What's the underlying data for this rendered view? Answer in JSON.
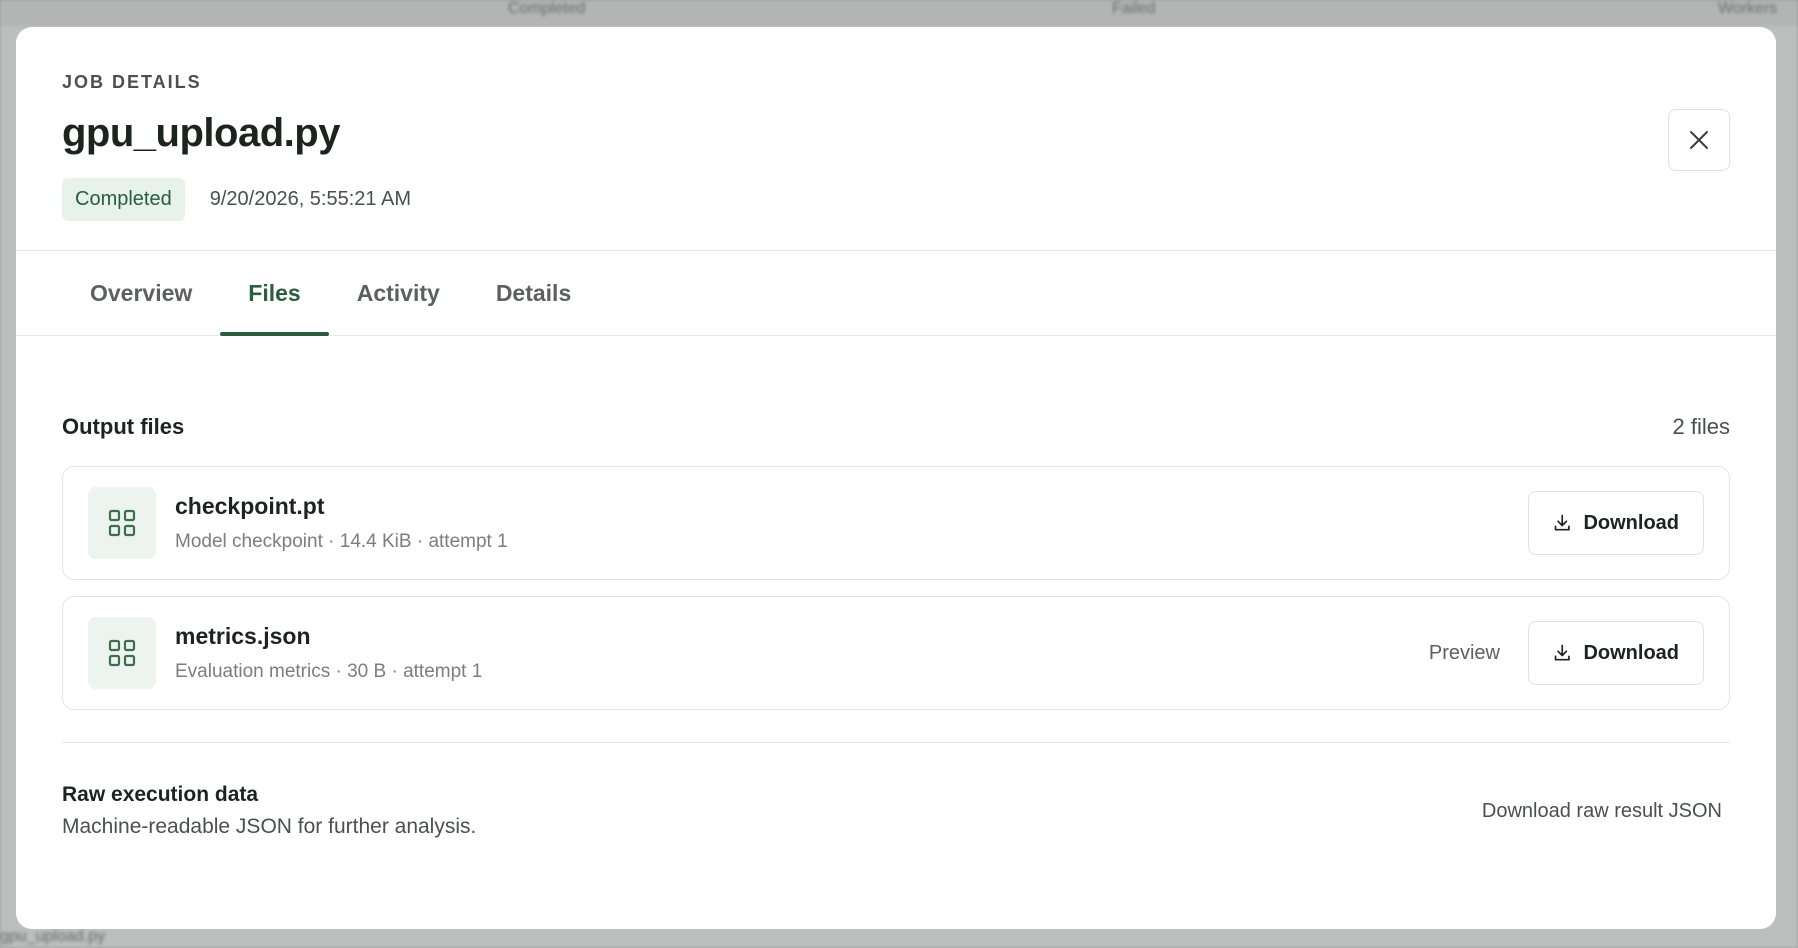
{
  "background": {
    "top_items": [
      "Completed",
      "Failed",
      "Workers"
    ],
    "bottom_item": "gpu_upload.py"
  },
  "modal": {
    "eyebrow": "JOB DETAILS",
    "title": "gpu_upload.py",
    "status": "Completed",
    "timestamp": "9/20/2026, 5:55:21 AM"
  },
  "tabs": [
    {
      "label": "Overview",
      "active": false
    },
    {
      "label": "Files",
      "active": true
    },
    {
      "label": "Activity",
      "active": false
    },
    {
      "label": "Details",
      "active": false
    }
  ],
  "files_section": {
    "title": "Output files",
    "count": "2 files",
    "files": [
      {
        "name": "checkpoint.pt",
        "meta": "Model checkpoint · 14.4 KiB · attempt 1",
        "download_label": "Download"
      },
      {
        "name": "metrics.json",
        "meta": "Evaluation metrics · 30 B · attempt 1",
        "preview_label": "Preview",
        "download_label": "Download"
      }
    ]
  },
  "raw": {
    "title": "Raw execution data",
    "description": "Machine-readable JSON for further analysis.",
    "link": "Download raw result JSON"
  },
  "colors": {
    "accent": "#2b5d3e",
    "badge_bg": "#e7f2ea",
    "icon_bg": "#edf3ef"
  }
}
